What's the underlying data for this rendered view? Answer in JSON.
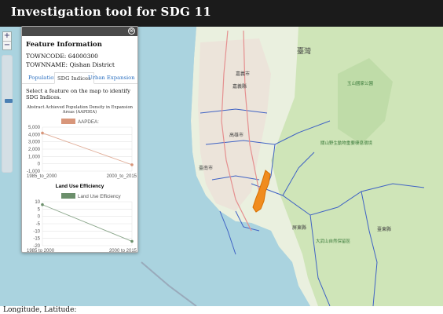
{
  "header": {
    "title": "Investigation tool for SDG 11"
  },
  "zoom": {
    "in_label": "+",
    "out_label": "−"
  },
  "panel": {
    "close_label": "⊗",
    "title": "Feature Information",
    "towncode": "TOWNCODE: 64000300",
    "townname": "TOWNNAME: Qishan District",
    "tabs": [
      "Population",
      "SDG Indices",
      "Urban Expansion"
    ],
    "active_tab": "SDG Indices",
    "instruction": "Select a feature on the map to identify SDG Indices.",
    "section_title": "Abstract Achieved Population Density in Expansion Areas (AAPDEA)"
  },
  "chart_data": [
    {
      "type": "line",
      "title": "",
      "legend": "AAPDEA:",
      "legend_color": "#d8967a",
      "categories": [
        "1985_to_2000",
        "2000_to_2015"
      ],
      "series": [
        {
          "name": "AAPDEA:",
          "values": [
            4200,
            -130
          ]
        }
      ],
      "ylim": [
        -1000,
        5000
      ],
      "yticks": [
        "5,000",
        "4,000",
        "3,000",
        "2,000",
        "1,000",
        "0",
        "-1,000"
      ],
      "grid": true
    },
    {
      "type": "line",
      "title": "Land Use Efficiency",
      "legend": "Land Use Efficiency",
      "legend_color": "#6b8f6b",
      "categories": [
        "1985 to 2000",
        "2000 to 2015"
      ],
      "series": [
        {
          "name": "Land Use Efficiency",
          "values": [
            8,
            -17
          ]
        }
      ],
      "ylim": [
        -20,
        10
      ],
      "yticks": [
        "10",
        "5",
        "0",
        "-5",
        "-10",
        "-15",
        "-20"
      ],
      "grid": true
    }
  ],
  "map": {
    "labels": [
      "臺灣",
      "嘉義市",
      "嘉義縣",
      "臺南市",
      "高雄市",
      "臺東縣",
      "屏東縣",
      "大武山自然保留區",
      "關山野生動物重要棲息環境",
      "玉山國家公園"
    ],
    "highlight_color": "#f08c1e"
  },
  "footer": {
    "coords_label": "Longitude, Latitude:"
  }
}
